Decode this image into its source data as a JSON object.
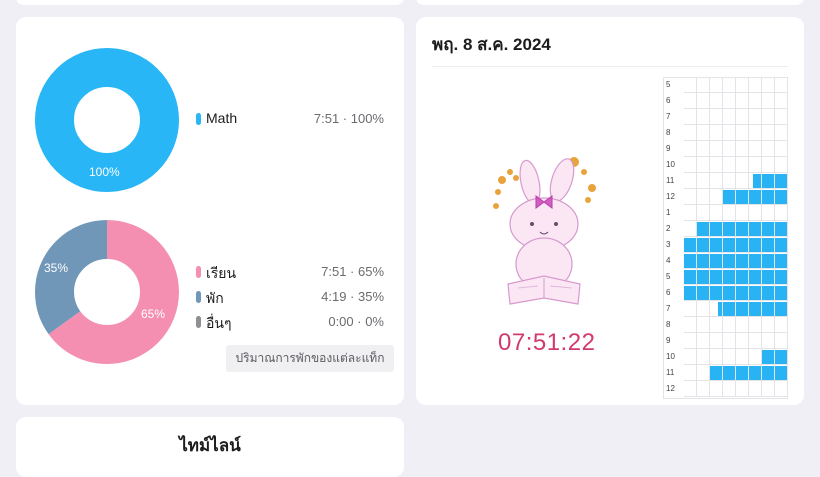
{
  "subject_chart": {
    "percent_label": "100%",
    "legend": [
      {
        "name": "Math",
        "value": "7:51 · 100%",
        "color": "#29b6f6"
      }
    ]
  },
  "break_chart": {
    "label_study": "65%",
    "label_break": "35%",
    "legend": [
      {
        "name": "เรียน",
        "value": "7:51 · 65%",
        "color": "#f48fb1"
      },
      {
        "name": "พัก",
        "value": "4:19 · 35%",
        "color": "#7096b8"
      },
      {
        "name": "อื่นๆ",
        "value": "0:00 · 0%",
        "color": "#8e8e93"
      }
    ],
    "button_label": "ปริมาณการพักของแต่ละแท็ก"
  },
  "day_panel": {
    "date": "พฤ. 8 ส.ค. 2024",
    "timer": "07:51:22",
    "hours": [
      "5",
      "6",
      "7",
      "8",
      "9",
      "10",
      "11",
      "12",
      "1",
      "2",
      "3",
      "4",
      "5",
      "6",
      "7",
      "8",
      "9",
      "10",
      "11",
      "12"
    ],
    "study_fraction_by_hour": [
      0,
      0,
      0,
      0,
      0,
      0,
      0.33,
      0.62,
      0,
      0.88,
      1,
      1,
      1,
      1,
      0.67,
      0,
      0,
      0.25,
      0.75,
      0
    ]
  },
  "timeline": {
    "title": "ไทม์ไลน์"
  }
}
